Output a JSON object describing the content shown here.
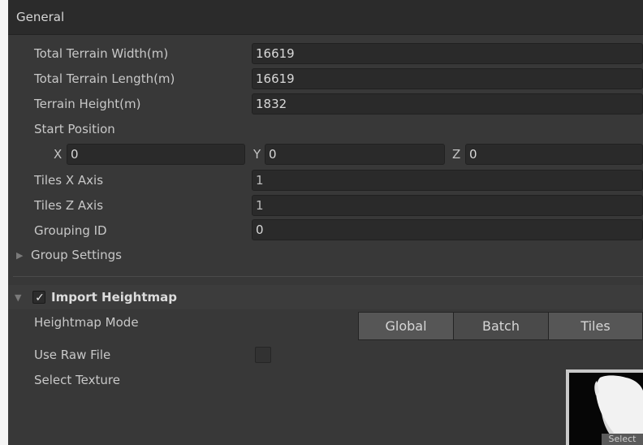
{
  "general": {
    "title": "General",
    "total_terrain_width": {
      "label": "Total Terrain Width(m)",
      "value": "16619"
    },
    "total_terrain_length": {
      "label": "Total Terrain Length(m)",
      "value": "16619"
    },
    "terrain_height": {
      "label": "Terrain Height(m)",
      "value": "1832"
    },
    "start_position": {
      "label": "Start Position",
      "x_label": "X",
      "x_value": "0",
      "y_label": "Y",
      "y_value": "0",
      "z_label": "Z",
      "z_value": "0"
    },
    "tiles_x_axis": {
      "label": "Tiles X Axis",
      "value": "1"
    },
    "tiles_z_axis": {
      "label": "Tiles Z Axis",
      "value": "1"
    },
    "grouping_id": {
      "label": "Grouping ID",
      "value": "0"
    },
    "group_settings": {
      "label": "Group Settings",
      "expanded": false
    }
  },
  "import_heightmap": {
    "title": "Import Heightmap",
    "enabled": true,
    "heightmap_mode": {
      "label": "Heightmap Mode",
      "options": [
        "Global",
        "Batch",
        "Tiles"
      ],
      "selected": "Batch"
    },
    "use_raw_file": {
      "label": "Use Raw File",
      "checked": false
    },
    "select_texture": {
      "label": "Select Texture",
      "button_label": "Select"
    }
  },
  "icons": {
    "check": "check-icon",
    "foldout_collapsed": "triangle-right-icon",
    "foldout_expanded": "triangle-down-icon"
  },
  "colors": {
    "panel_bg": "#383838",
    "field_bg": "#2a2a2a",
    "header_bg": "#2b2b2b",
    "segment_selected": "#4a4a4a",
    "segment_unselected": "#565656"
  }
}
